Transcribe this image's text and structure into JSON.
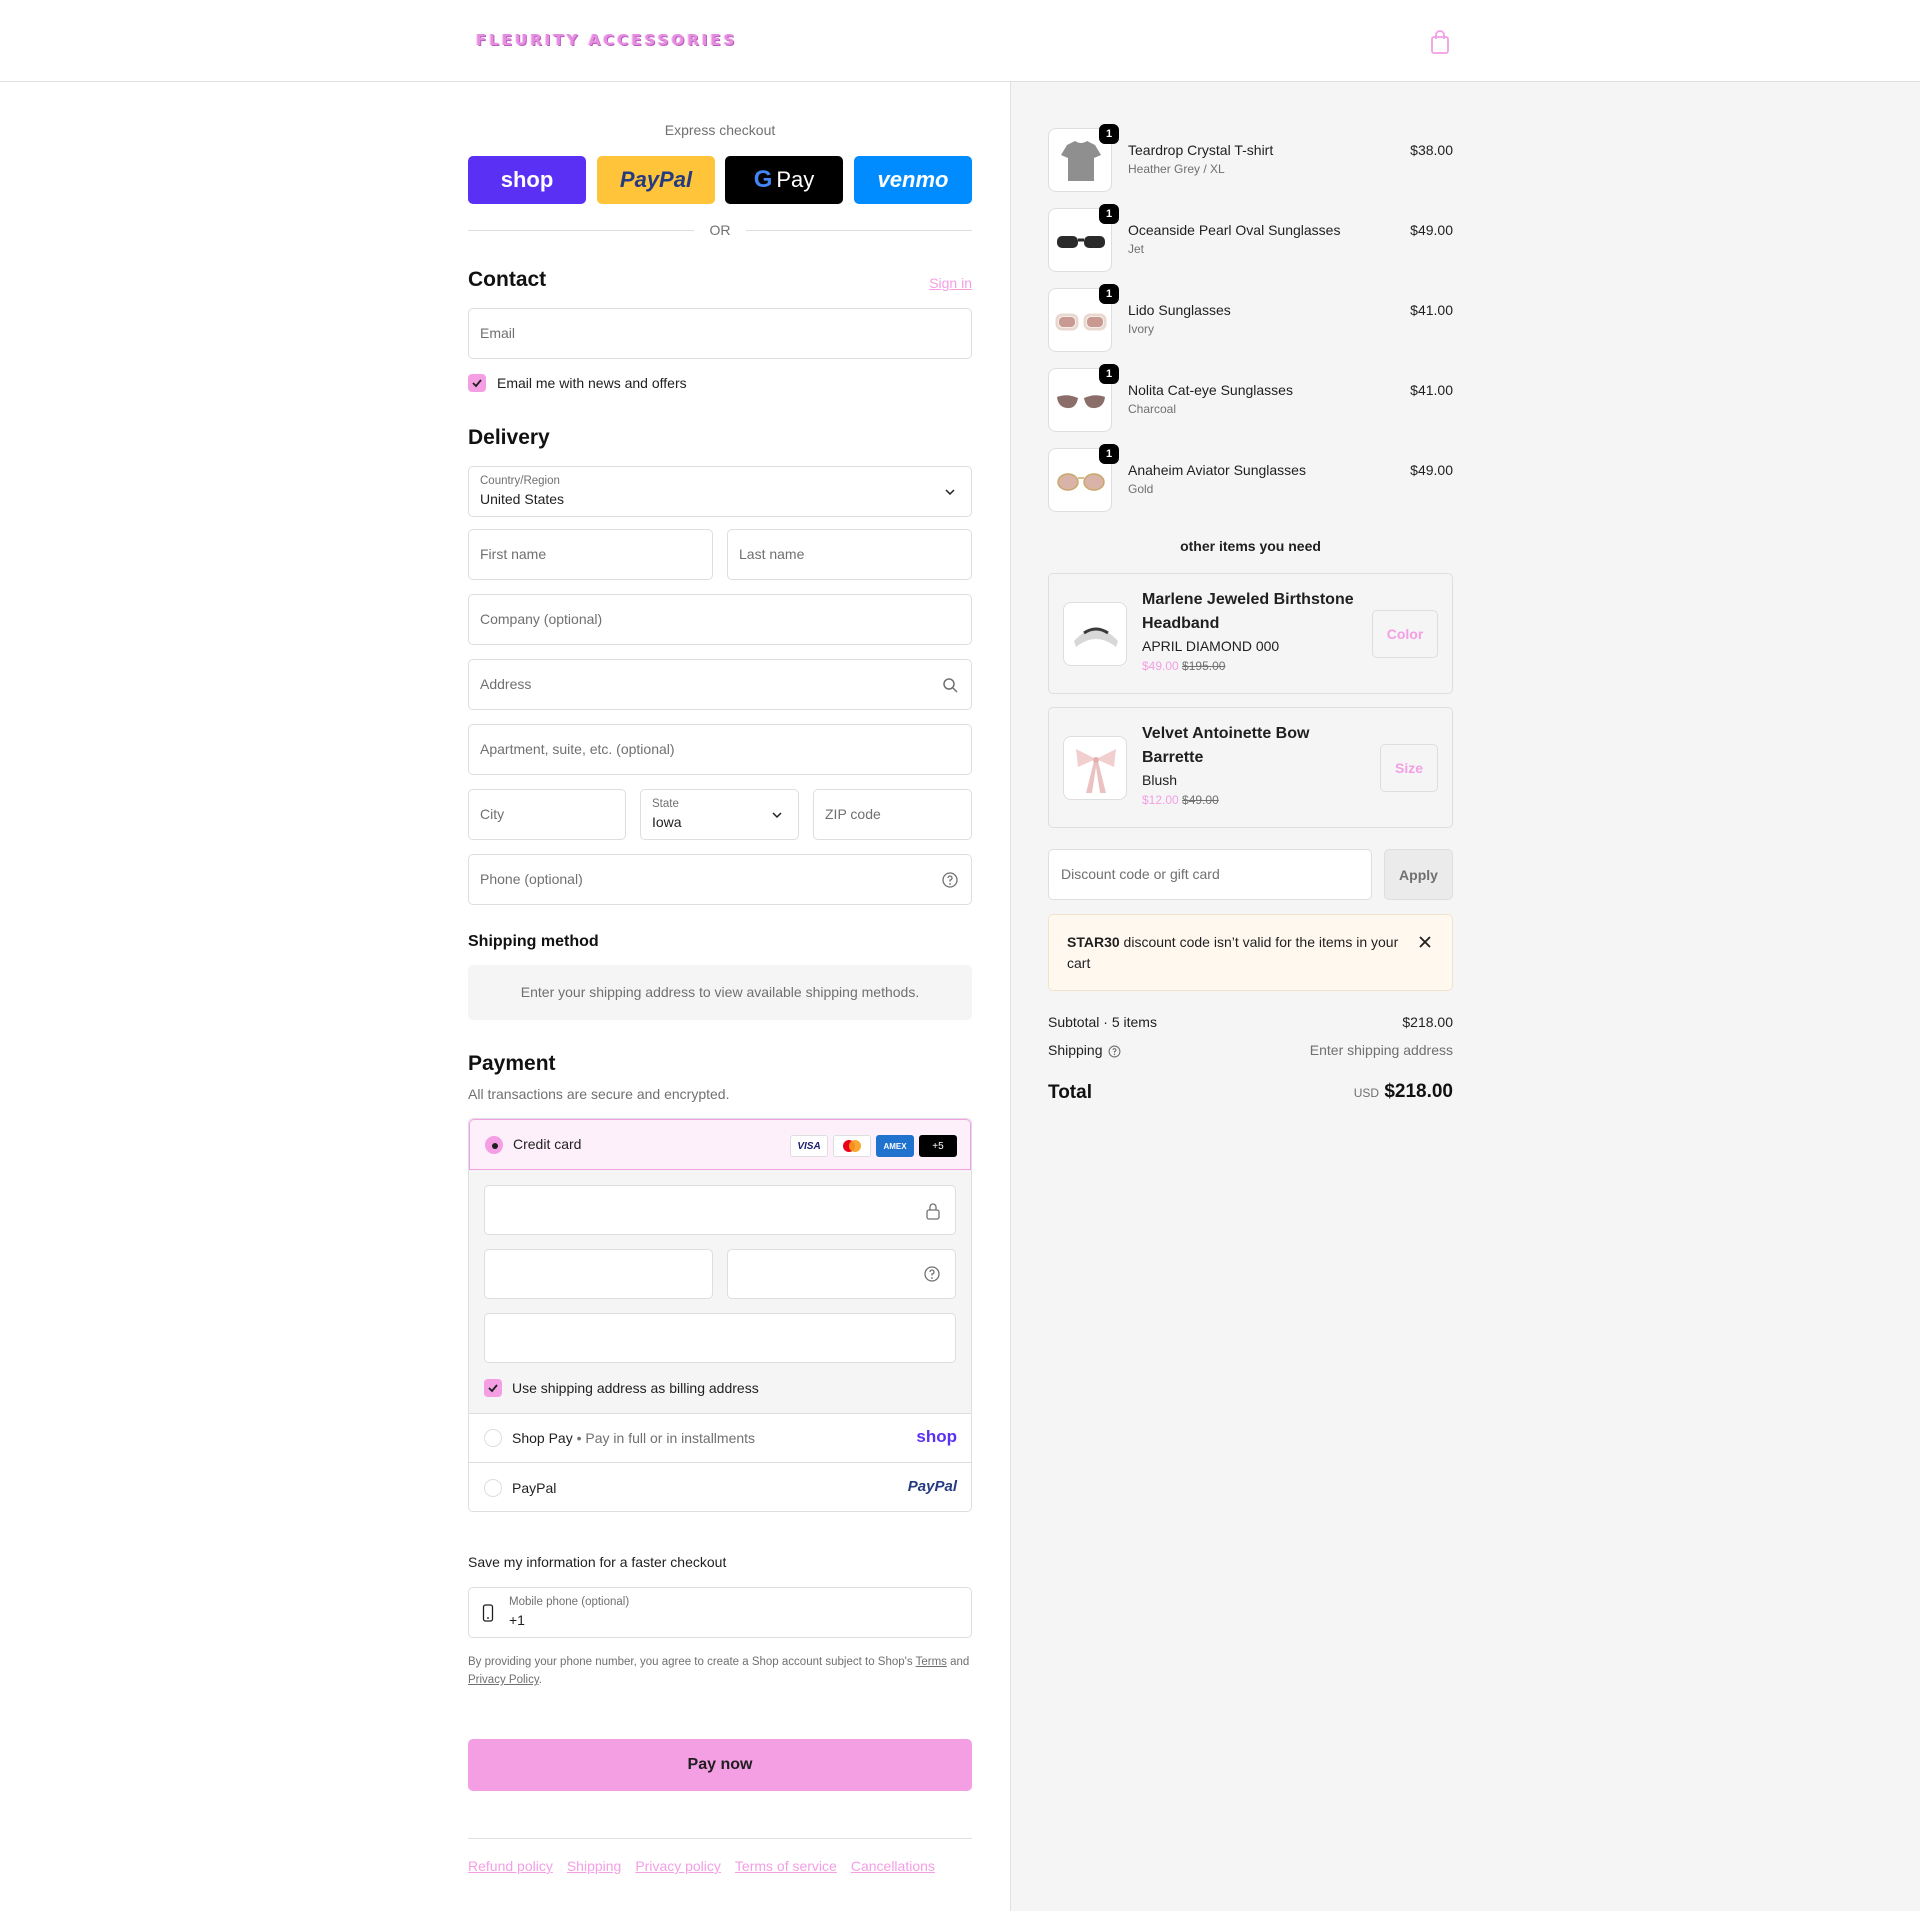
{
  "header": {
    "logo_text": "FLEURITY ACCESSORIES",
    "cart_icon": "shopping-bag-icon"
  },
  "express": {
    "title": "Express checkout",
    "buttons": [
      {
        "label": "shop",
        "bg": "#5a31f4",
        "color": "#ffffff"
      },
      {
        "label": "PayPal",
        "bg": "#ffc439",
        "color": "#253b80"
      },
      {
        "label": "Pay",
        "bg": "#000000",
        "color": "#ffffff"
      },
      {
        "label": "venmo",
        "bg": "#008cff",
        "color": "#ffffff"
      }
    ],
    "or": "OR"
  },
  "contact": {
    "heading": "Contact",
    "sign_in": "Sign in",
    "email_placeholder": "Email",
    "news_label": "Email me with news and offers",
    "news_checked": true
  },
  "delivery": {
    "heading": "Delivery",
    "country_label": "Country/Region",
    "country_value": "United States",
    "first_name": "First name",
    "last_name": "Last name",
    "company": "Company (optional)",
    "address": "Address",
    "apartment": "Apartment, suite, etc. (optional)",
    "city": "City",
    "state_label": "State",
    "state_value": "Iowa",
    "zip": "ZIP code",
    "phone": "Phone (optional)"
  },
  "shipping": {
    "heading": "Shipping method",
    "note": "Enter your shipping address to view available shipping methods."
  },
  "payment": {
    "heading": "Payment",
    "subtitle": "All transactions are secure and encrypted.",
    "credit_card_label": "Credit card",
    "cards": [
      "VISA",
      "MC",
      "AMEX",
      "+5"
    ],
    "billing_label": "Use shipping address as billing address",
    "billing_checked": true,
    "shop_pay_label": "Shop Pay",
    "shop_pay_sub": "Pay in full or in installments",
    "shop_pay_logo": "shop",
    "paypal_label": "PayPal",
    "paypal_logo": "PayPal"
  },
  "save_info": {
    "title": "Save my information for a faster checkout",
    "phone_label": "Mobile phone (optional)",
    "phone_value": "+1",
    "legal_pre": "By providing your phone number, you agree to create a Shop account subject to Shop's",
    "terms": "Terms",
    "and": "and",
    "privacy": "Privacy Policy",
    "period": "."
  },
  "pay_now": "Pay now",
  "footer_links": [
    "Refund policy",
    "Shipping",
    "Privacy policy",
    "Terms of service",
    "Cancellations"
  ],
  "order": {
    "items": [
      {
        "name": "Teardrop Crystal T-shirt",
        "variant": "Heather Grey / XL",
        "price": "$38.00",
        "qty": "1"
      },
      {
        "name": "Oceanside Pearl Oval Sunglasses",
        "variant": "Jet",
        "price": "$49.00",
        "qty": "1"
      },
      {
        "name": "Lido Sunglasses",
        "variant": "Ivory",
        "price": "$41.00",
        "qty": "1"
      },
      {
        "name": "Nolita Cat-eye Sunglasses",
        "variant": "Charcoal",
        "price": "$41.00",
        "qty": "1"
      },
      {
        "name": "Anaheim Aviator Sunglasses",
        "variant": "Gold",
        "price": "$49.00",
        "qty": "1"
      }
    ],
    "upsell_title": "other items you need",
    "upsells": [
      {
        "name": "Marlene Jeweled Birthstone Headband",
        "variant": "APRIL DIAMOND 000",
        "sale": "$49.00",
        "orig": "$195.00",
        "button": "Color"
      },
      {
        "name": "Velvet Antoinette Bow Barrette",
        "variant": "Blush",
        "sale": "$12.00",
        "orig": "$49.00",
        "button": "Size"
      }
    ],
    "discount_placeholder": "Discount code or gift card",
    "apply": "Apply",
    "alert_code": "STAR30",
    "alert_msg": "discount code isn’t valid for the items in your cart",
    "subtotal_label": "Subtotal · 5 items",
    "subtotal_value": "$218.00",
    "shipping_label": "Shipping",
    "shipping_value": "Enter shipping address",
    "total_label": "Total",
    "currency": "USD",
    "total_value": "$218.00"
  },
  "colors": {
    "accent": "#f49ee4",
    "muted": "#707070",
    "border": "#dedede",
    "panel": "#f5f5f5"
  }
}
